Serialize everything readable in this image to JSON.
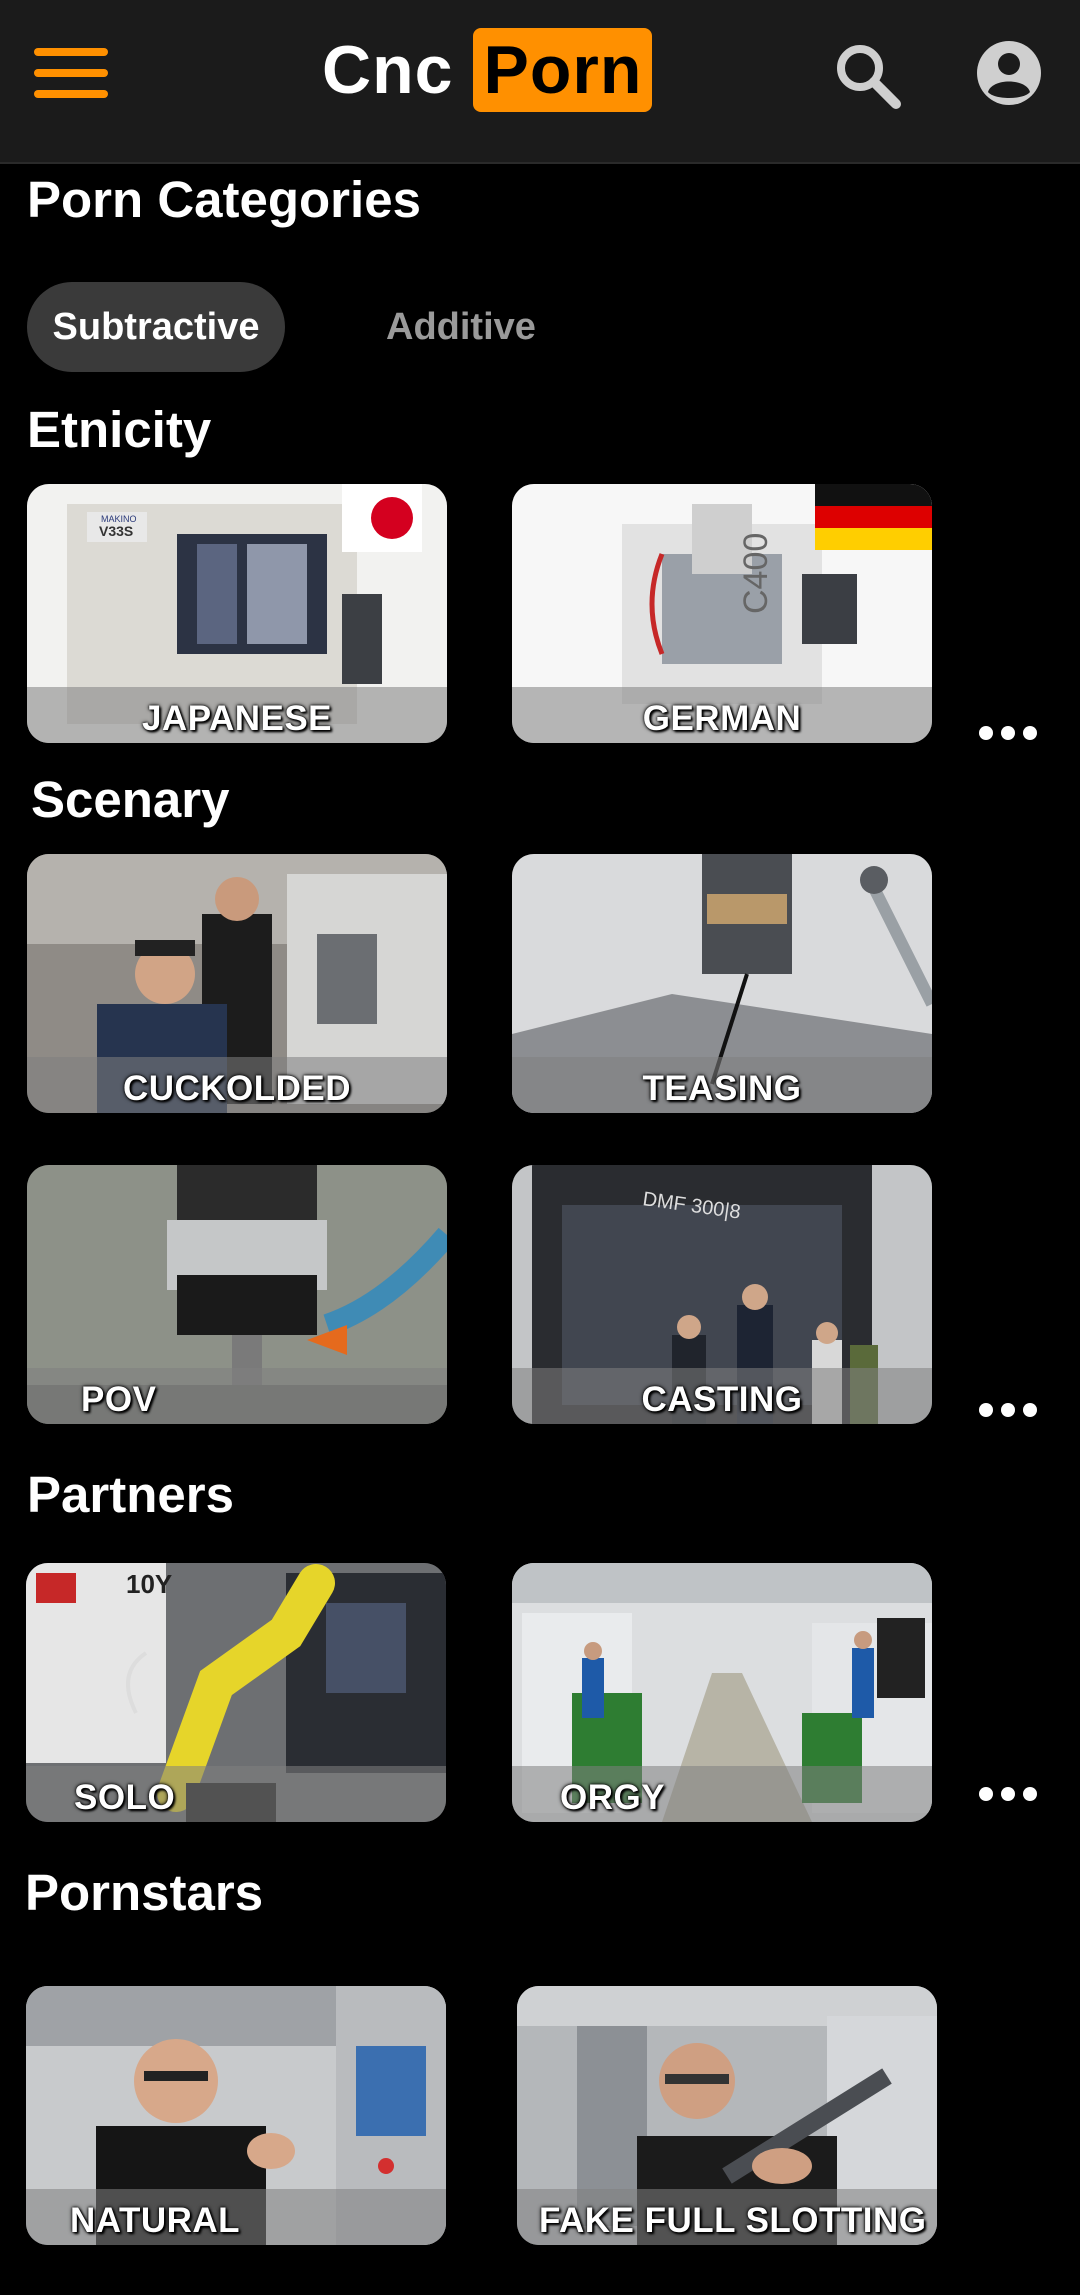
{
  "header": {
    "logo_text": "Cnc",
    "logo_box": "Porn",
    "menu_icon": "hamburger-menu-icon",
    "search_icon": "search-icon",
    "account_icon": "user-account-icon",
    "accent_color": "#ff9000"
  },
  "page_title": "Porn Categories",
  "tabs": [
    {
      "label": "Subtractive",
      "active": true
    },
    {
      "label": "Additive",
      "active": false
    }
  ],
  "sections": {
    "etnicity": {
      "title": "Etnicity",
      "cards": [
        {
          "label": "JAPANESE",
          "flag": "japan-flag-icon"
        },
        {
          "label": "GERMAN",
          "flag": "germany-flag-icon"
        }
      ]
    },
    "scenary": {
      "title": "Scenary",
      "cards": [
        {
          "label": "CUCKOLDED"
        },
        {
          "label": "TEASING"
        },
        {
          "label": "POV"
        },
        {
          "label": "CASTING"
        }
      ]
    },
    "partners": {
      "title": "Partners",
      "cards": [
        {
          "label": "SOLO"
        },
        {
          "label": "ORGY"
        }
      ]
    },
    "pornstars": {
      "title": "Pornstars",
      "cards": [
        {
          "label": "NATURAL"
        },
        {
          "label": "FAKE FULL SLOTTING"
        }
      ]
    }
  },
  "machine_labels": {
    "japanese_brand": "MAKINO",
    "japanese_model": "V33S",
    "german_model": "C400",
    "casting_model": "DMF 300|8",
    "solo_sign": "10Y"
  },
  "more_icon": "more-options-icon"
}
